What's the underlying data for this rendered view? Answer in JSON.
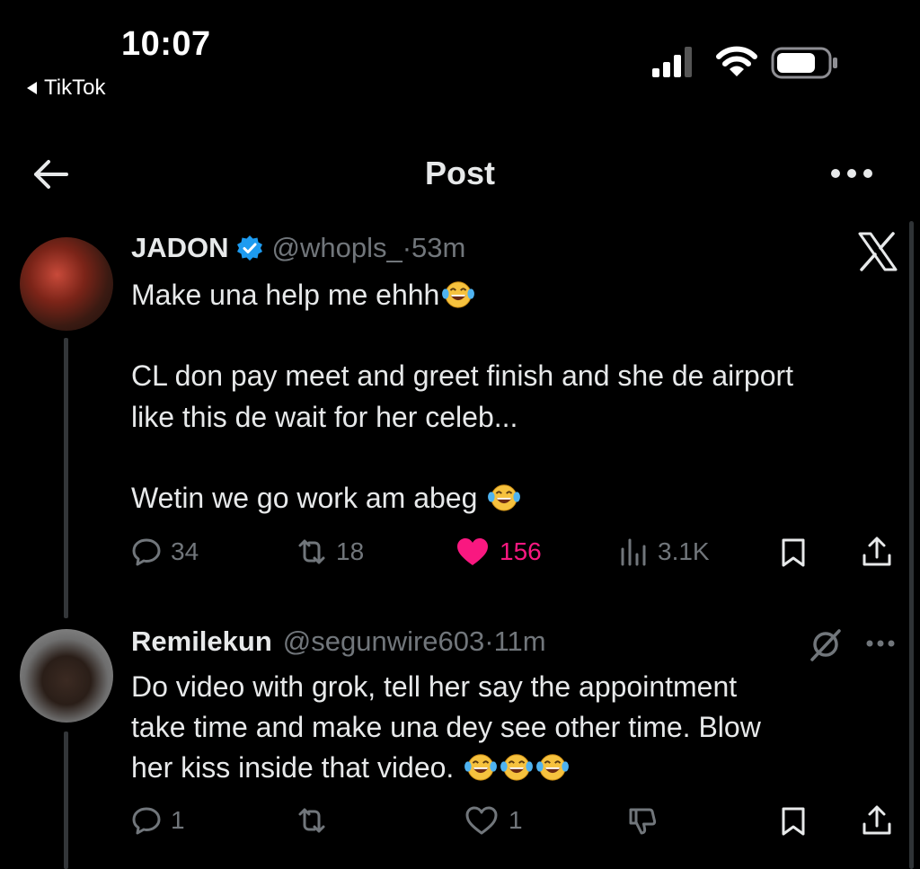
{
  "status_bar": {
    "time": "10:07",
    "back_app": "TikTok"
  },
  "nav": {
    "title": "Post"
  },
  "post": {
    "username": "JADON",
    "handle": "@whopls_",
    "time": "·53m",
    "lines": [
      "Make una help me ehhh",
      "CL don pay meet and greet finish and she de airport",
      "like this de wait for her celeb...",
      "Wetin we go work am abeg "
    ],
    "stats": {
      "replies": "34",
      "reposts": "18",
      "likes": "156",
      "views": "3.1K"
    },
    "like_color": "#f91880"
  },
  "reply": {
    "username": "Remilekun",
    "handle": "@segunwire603",
    "time": "·11m",
    "lines": [
      "Do video with grok, tell her say the appointment",
      "take time and make una dey see other time. Blow",
      "her kiss inside that video. "
    ],
    "stats": {
      "replies": "1",
      "likes": "1"
    }
  },
  "icons": [
    "back-arrow-icon",
    "more-icon",
    "verified-badge-icon",
    "x-logo-icon",
    "reply-icon",
    "repost-icon",
    "like-icon",
    "views-icon",
    "bookmark-icon",
    "share-icon",
    "grok-icon",
    "dislike-icon",
    "laughing-emoji-icon"
  ]
}
